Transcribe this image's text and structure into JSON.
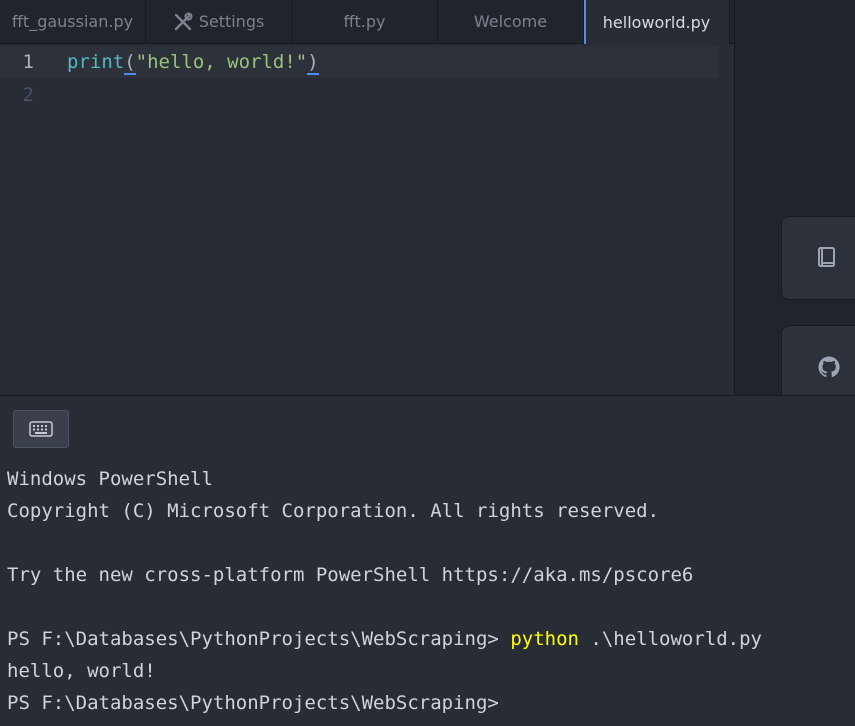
{
  "tabs": [
    {
      "label": "fft_gaussian.py",
      "icon": null,
      "active": false
    },
    {
      "label": "Settings",
      "icon": "settings-tools-icon",
      "active": false
    },
    {
      "label": "fft.py",
      "icon": null,
      "active": false
    },
    {
      "label": "Welcome",
      "icon": null,
      "active": false
    },
    {
      "label": "helloworld.py",
      "icon": null,
      "active": true
    }
  ],
  "editor": {
    "lines": [
      {
        "number": "1",
        "fn": "print",
        "open_paren": "(",
        "string": "\"hello, world!\"",
        "close_paren": ")"
      },
      {
        "number": "2"
      }
    ]
  },
  "dock": {
    "buttons": [
      {
        "icon": "book-icon"
      },
      {
        "icon": "github-icon"
      }
    ]
  },
  "terminal": {
    "keyboard_icon": "keyboard-icon",
    "lines": {
      "l1": "Windows PowerShell",
      "l2": "Copyright (C) Microsoft Corporation. All rights reserved.",
      "l3": "",
      "l4": "Try the new cross-platform PowerShell https://aka.ms/pscore6",
      "l5": "",
      "prompt1": "PS F:\\Databases\\PythonProjects\\WebScraping> ",
      "command": "python",
      "args": " .\\helloworld.py",
      "output": "hello, world!",
      "prompt2": "PS F:\\Databases\\PythonProjects\\WebScraping>"
    }
  },
  "colors": {
    "background": "#282c34",
    "tabbar": "#21252b",
    "accent": "#568af2",
    "function": "#56b6c2",
    "string": "#98c379",
    "command": "#ffff00"
  }
}
